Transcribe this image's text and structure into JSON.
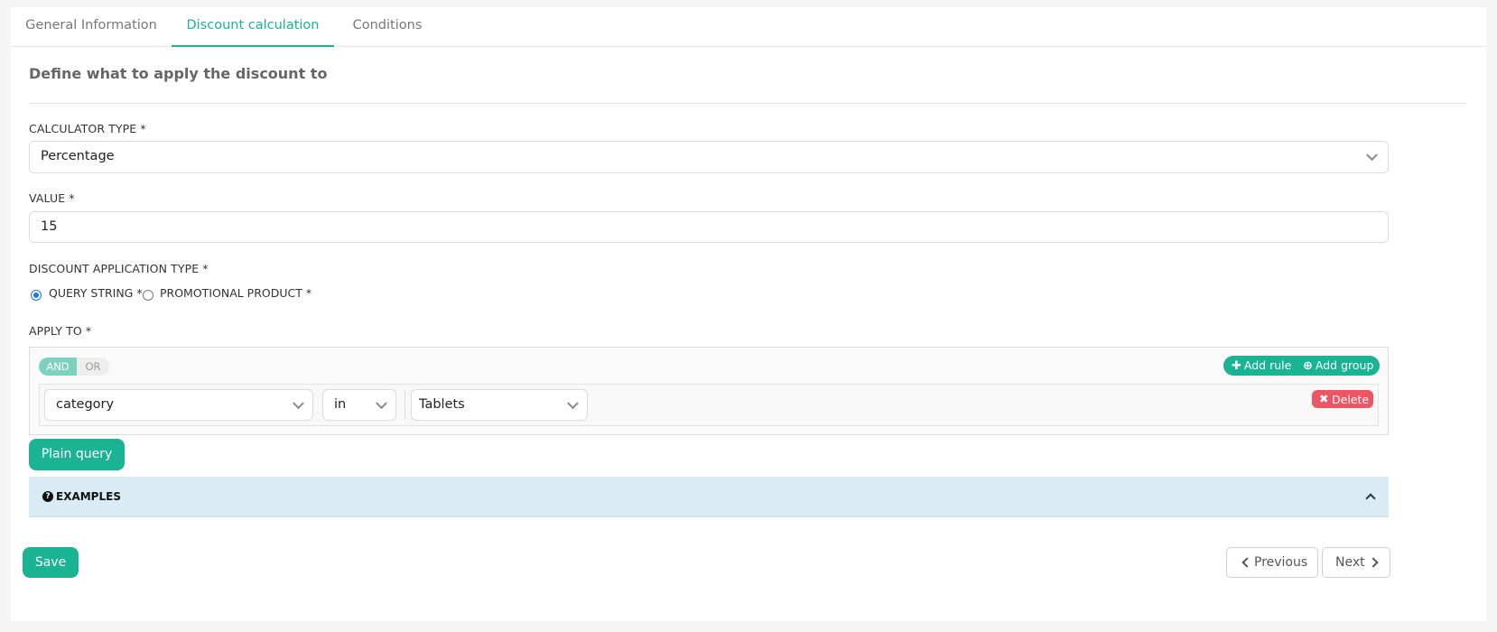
{
  "tabs": [
    {
      "label": "General Information"
    },
    {
      "label": "Discount calculation"
    },
    {
      "label": "Conditions"
    }
  ],
  "section_title": "Define what to apply the discount to",
  "calculator_type": {
    "label": "CALCULATOR TYPE *",
    "value": "Percentage"
  },
  "value_field": {
    "label": "VALUE *",
    "value": "15"
  },
  "application_type": {
    "label": "DISCOUNT APPLICATION TYPE *",
    "options": [
      {
        "label": "QUERY STRING *",
        "checked": true
      },
      {
        "label": "PROMOTIONAL PRODUCT *",
        "checked": false
      }
    ]
  },
  "apply_to": {
    "label": "APPLY TO *",
    "condition_and": "AND",
    "condition_or": "OR",
    "add_rule": "Add rule",
    "add_group": "Add group",
    "rule": {
      "field": "category",
      "operator": "in",
      "value": "Tablets",
      "delete": "Delete"
    }
  },
  "plain_query": "Plain query",
  "examples_label": "EXAMPLES",
  "footer": {
    "save": "Save",
    "previous": "Previous",
    "next": "Next"
  },
  "colors": {
    "accent": "#1ab394",
    "danger": "#ed5565",
    "info_bg": "#d9ebf5"
  }
}
